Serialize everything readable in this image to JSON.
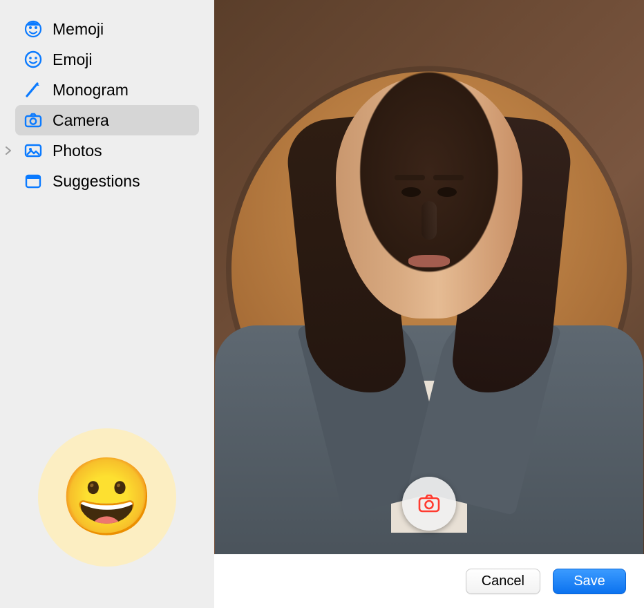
{
  "sidebar": {
    "items": [
      {
        "label": "Memoji",
        "icon": "memoji-icon",
        "selected": false,
        "disclosure": false
      },
      {
        "label": "Emoji",
        "icon": "emoji-icon",
        "selected": false,
        "disclosure": false
      },
      {
        "label": "Monogram",
        "icon": "monogram-icon",
        "selected": false,
        "disclosure": false
      },
      {
        "label": "Camera",
        "icon": "camera-icon",
        "selected": true,
        "disclosure": false
      },
      {
        "label": "Photos",
        "icon": "photos-icon",
        "selected": false,
        "disclosure": true
      },
      {
        "label": "Suggestions",
        "icon": "suggestions-icon",
        "selected": false,
        "disclosure": false
      }
    ],
    "preview_emoji": "😀"
  },
  "footer": {
    "cancel_label": "Cancel",
    "save_label": "Save"
  },
  "colors": {
    "accent_blue": "#0b72ef",
    "icon_blue": "#0a7aff",
    "sidebar_bg": "#eeeeee",
    "selected_bg": "#d6d6d6",
    "shutter_red": "#ff3b30"
  }
}
